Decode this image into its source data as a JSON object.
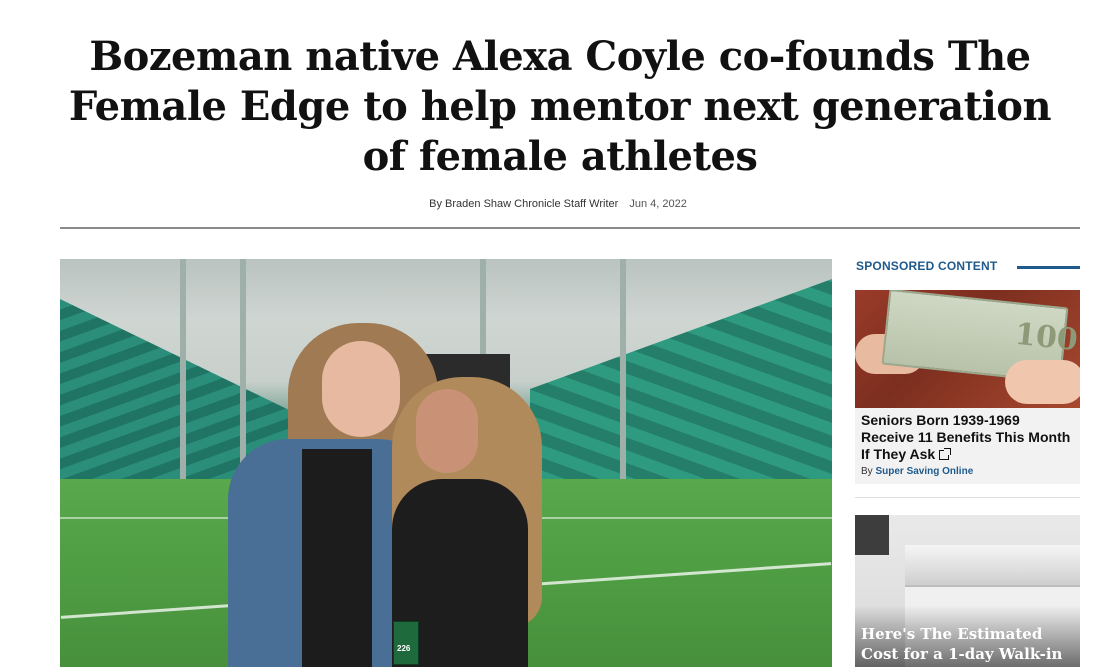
{
  "article": {
    "headline": "Bozeman native Alexa Coyle co-founds The Female Edge to help mentor next generation of female athletes",
    "byline": "By Braden Shaw Chronicle Staff Writer",
    "date": "Jun 4, 2022"
  },
  "sidebar": {
    "heading": "SPONSORED CONTENT",
    "ads": [
      {
        "title": "Seniors Born 1939-1969 Receive 11 Benefits This Month If They Ask",
        "by_label": "By",
        "source": "Super Saving Online",
        "image_icon": "money-hands-image"
      },
      {
        "title": "Here's The Estimated Cost for a 1-day Walk-in",
        "image_icon": "bathroom-vanity-image"
      }
    ]
  },
  "photo": {
    "icon": "stadium-photo",
    "badge_text": "226"
  },
  "colors": {
    "accent": "#1f5a8c",
    "rule": "#8a8a8a"
  }
}
